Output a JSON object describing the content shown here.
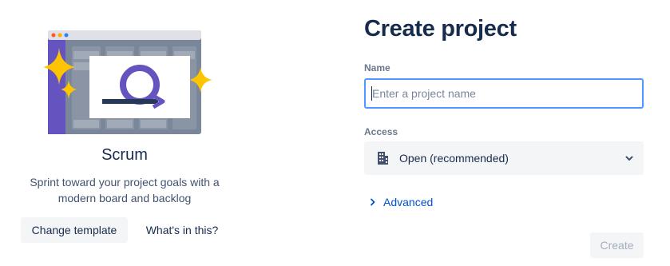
{
  "template": {
    "title": "Scrum",
    "description": "Sprint toward your project goals with a modern board and backlog",
    "change_template_label": "Change template",
    "whats_in_this_label": "What's in this?",
    "illustration_icon": "scrum-loop-icon"
  },
  "form": {
    "title": "Create project",
    "name": {
      "label": "Name",
      "placeholder": "Enter a project name",
      "value": ""
    },
    "access": {
      "label": "Access",
      "selected": "Open (recommended)",
      "icon": "building-icon"
    },
    "advanced_label": "Advanced",
    "create_label": "Create"
  },
  "colors": {
    "text_primary": "#172b4d",
    "label": "#6b778c",
    "link": "#0052cc",
    "focus_border": "#4c9aff",
    "scrum_purple": "#6554c0",
    "button_bg": "#f4f5f7",
    "disabled_text": "#a5adba",
    "sparkle": "#ffc400"
  }
}
